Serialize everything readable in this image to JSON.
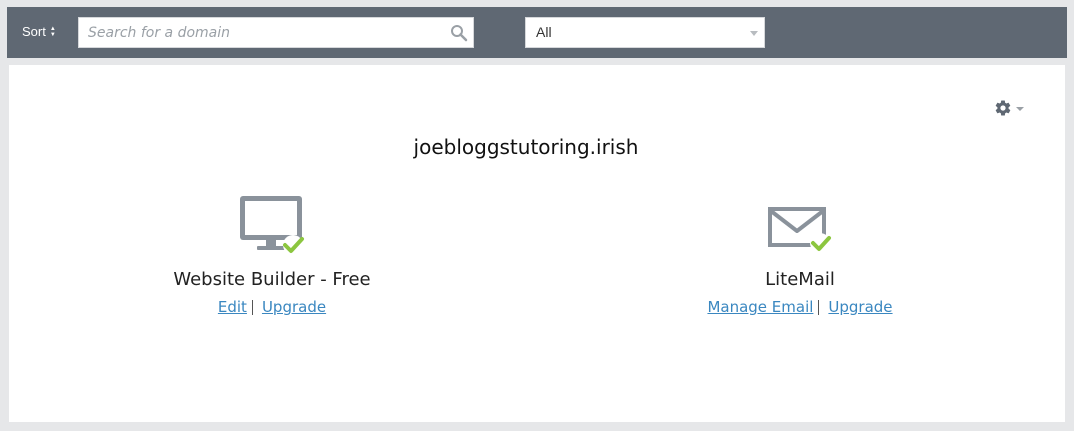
{
  "toolbar": {
    "sort_label": "Sort",
    "sort_icon": "sort-arrows-icon",
    "search": {
      "placeholder": "Search for a domain",
      "value": ""
    },
    "filter": {
      "selected": "All"
    }
  },
  "domain": {
    "name": "joebloggstutoring.irish",
    "settings_icon": "gear-icon"
  },
  "services": [
    {
      "name": "Website Builder - Free",
      "icon": "monitor-check-icon",
      "links": [
        "Edit",
        "Upgrade"
      ]
    },
    {
      "name": "LiteMail",
      "icon": "envelope-check-icon",
      "links": [
        "Manage Email",
        "Upgrade"
      ]
    }
  ],
  "colors": {
    "toolbar_bg": "#5f6873",
    "link": "#3a87c0",
    "icon_gray": "#8a929b",
    "check_green": "#8cc63f"
  }
}
